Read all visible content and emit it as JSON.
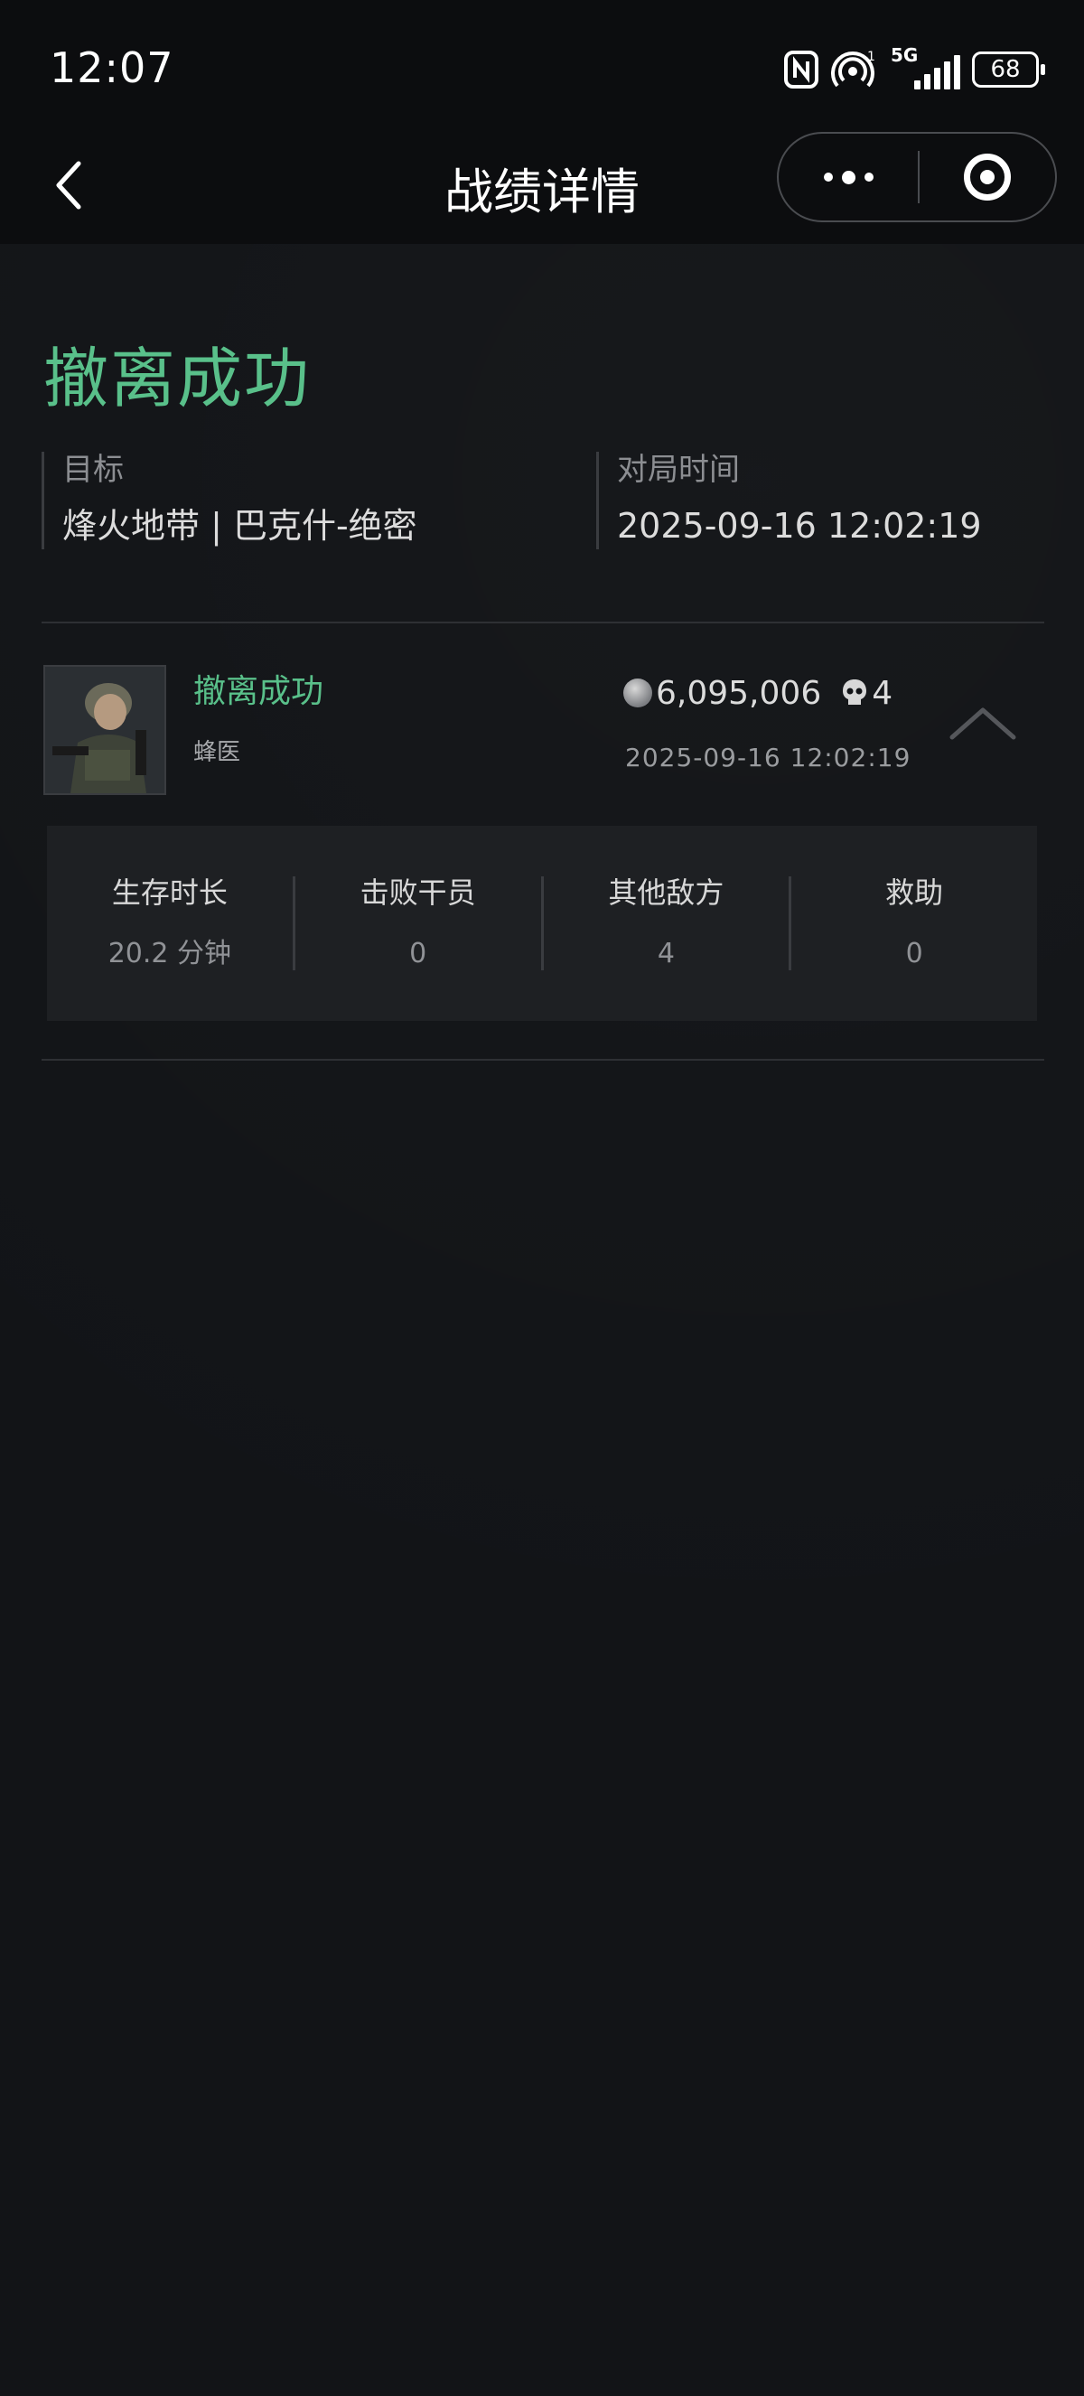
{
  "status_bar": {
    "time": "12:07",
    "network_label": "5G",
    "sim_index": "1",
    "battery": "68"
  },
  "nav": {
    "title": "战绩详情"
  },
  "result": {
    "title": "撤离成功",
    "target_label": "目标",
    "target_value": "烽火地带 | 巴克什-绝密",
    "time_label": "对局时间",
    "time_value": "2025-09-16 12:02:19"
  },
  "record": {
    "status": "撤离成功",
    "operator": "蜂医",
    "assets": "6,095,006",
    "kills": "4",
    "time": "2025-09-16 12:02:19"
  },
  "stats": [
    {
      "label": "生存时长",
      "value": "20.2 分钟"
    },
    {
      "label": "击败干员",
      "value": "0"
    },
    {
      "label": "其他敌方",
      "value": "4"
    },
    {
      "label": "救助",
      "value": "0"
    }
  ],
  "colors": {
    "accent_green": "#59c08a",
    "background": "#121417",
    "panel": "#1e2023"
  }
}
